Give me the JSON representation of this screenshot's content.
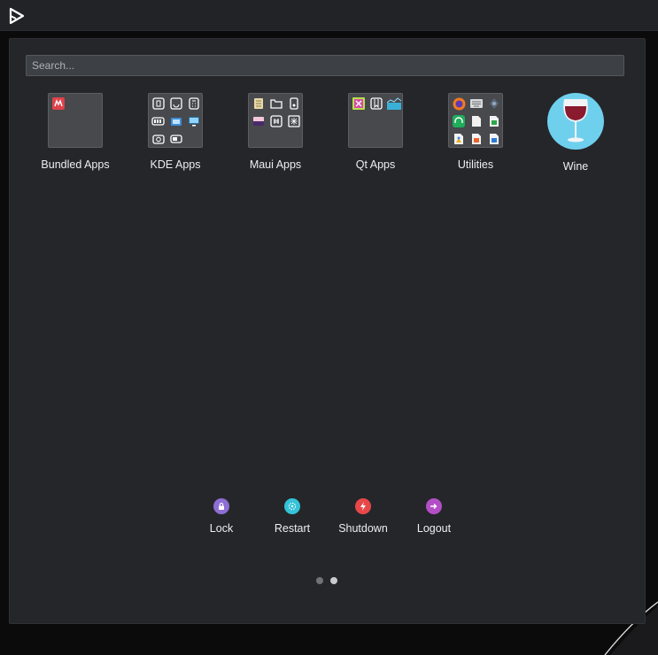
{
  "search": {
    "placeholder": "Search..."
  },
  "apps": [
    {
      "label": "Bundled Apps",
      "type": "folder"
    },
    {
      "label": "KDE Apps",
      "type": "folder"
    },
    {
      "label": "Maui Apps",
      "type": "folder"
    },
    {
      "label": "Qt Apps",
      "type": "folder"
    },
    {
      "label": "Utilities",
      "type": "folder"
    },
    {
      "label": "Wine",
      "type": "app"
    }
  ],
  "session": {
    "lock": {
      "label": "Lock",
      "color": "#8e6ed6",
      "icon": "lock-icon"
    },
    "restart": {
      "label": "Restart",
      "color": "#34c3d8",
      "icon": "restart-icon"
    },
    "shutdown": {
      "label": "Shutdown",
      "color": "#e8474a",
      "icon": "power-icon"
    },
    "logout": {
      "label": "Logout",
      "color": "#b34fc6",
      "icon": "logout-icon"
    }
  },
  "pager": {
    "pages": 2,
    "current": 2
  },
  "colors": {
    "panel": "#25262a",
    "folder": "#47494d",
    "wine": "#6fd0ee",
    "dot_active": "#c8cbce",
    "dot_inactive": "#6f7276"
  }
}
